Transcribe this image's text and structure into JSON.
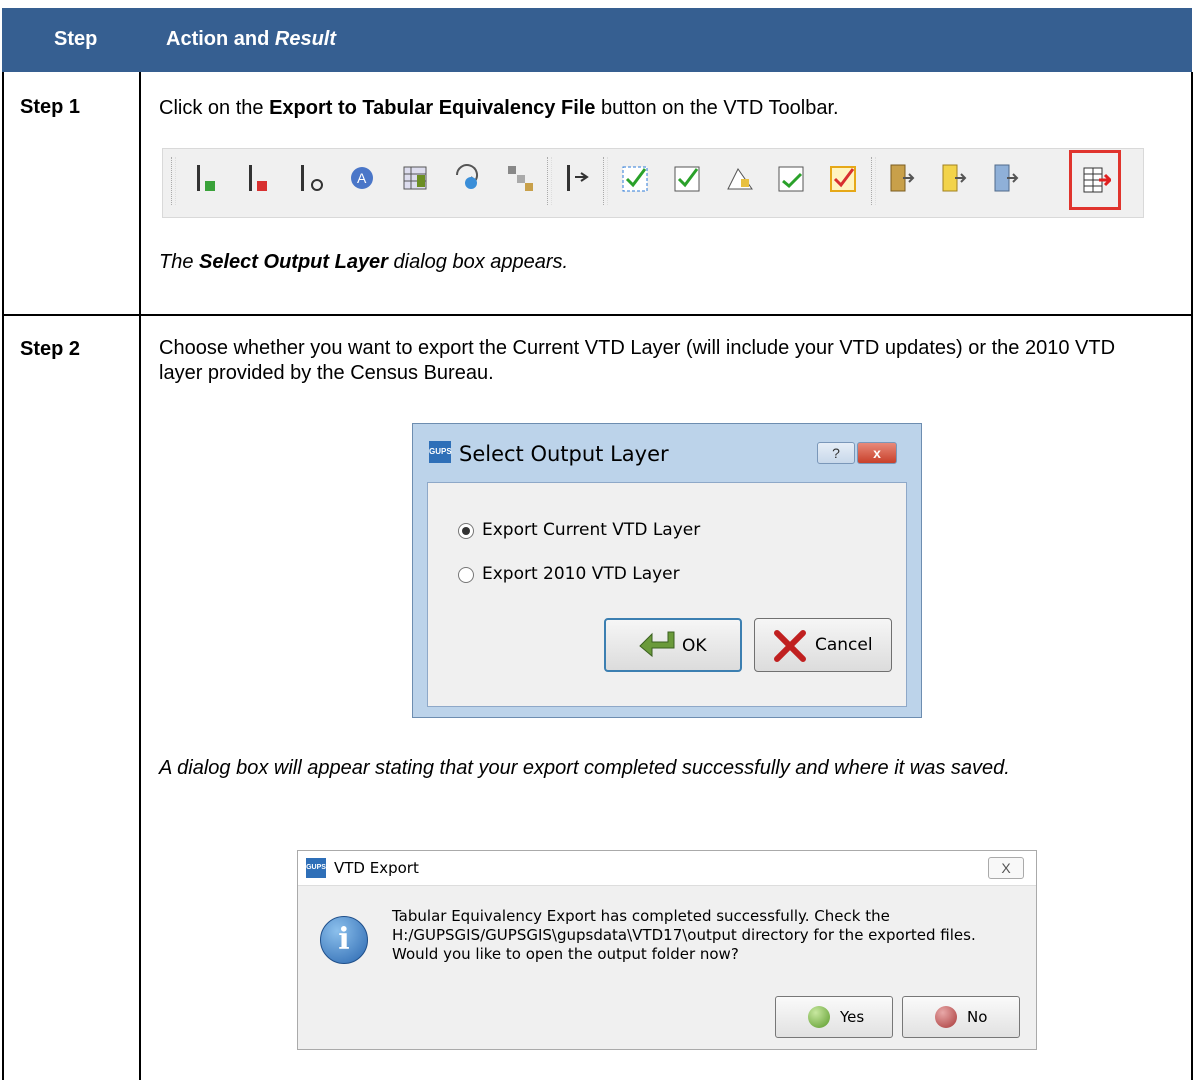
{
  "header": {
    "col_step": "Step",
    "col_action": "Action and ",
    "col_action_italic": "Result"
  },
  "step1": {
    "label": "Step 1",
    "text_pre": "Click on the ",
    "text_bold": "Export to Tabular Equivalency File",
    "text_post": " button on the VTD Toolbar.",
    "result_pre": "The ",
    "result_bold": "Select Output Layer",
    "result_post": " dialog box appears."
  },
  "step2": {
    "label": "Step 2",
    "text": "Choose whether you want to export the Current VTD Layer (will include your VTD updates) or the 2010 VTD layer provided by the Census Bureau.",
    "result": "A dialog box will appear stating that your export completed successfully and where it was saved."
  },
  "dialog_select": {
    "logo": "GUPS",
    "title": "Select Output Layer",
    "help": "?",
    "close": "x",
    "option1": "Export Current VTD Layer",
    "option2": "Export 2010 VTD Layer",
    "ok": "OK",
    "cancel": "Cancel"
  },
  "dialog_export": {
    "logo": "GUPS",
    "title": "VTD Export",
    "close": "X",
    "info_glyph": "i",
    "message": "Tabular Equivalency Export has completed successfully. Check the H:/GUPSGIS/GUPSGIS\\gupsdata\\VTD17\\output directory for the exported files. Would you like to open the output folder now?",
    "yes": "Yes",
    "no": "No"
  },
  "toolbar_icons": [
    "add-line-icon",
    "delete-line-icon",
    "split-line-icon",
    "label-icon",
    "table-edit-icon",
    "zoom-select-icon",
    "relate-icon",
    "flip-icon",
    "check-icon",
    "validate-icon",
    "lock-icon",
    "accept-icon",
    "review-icon",
    "export-zip-icon",
    "export-yellow-icon",
    "export-blue-icon",
    "export-tabular-equivalency-icon"
  ]
}
